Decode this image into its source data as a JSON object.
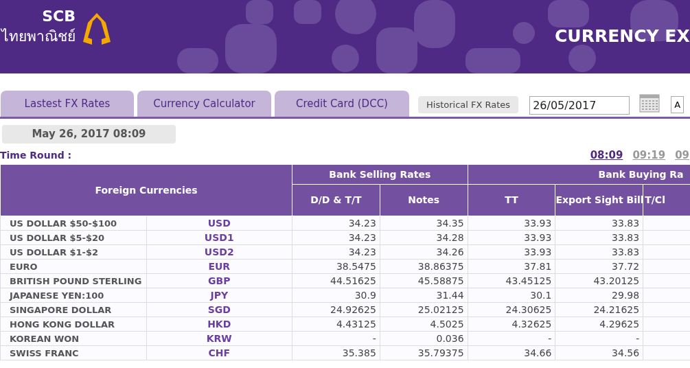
{
  "header": {
    "logo_text": "SCB",
    "logo_subtext": "ไทยพาณิชย์",
    "title": "CURRENCY EX"
  },
  "tabs": [
    {
      "label": "Lastest FX Rates",
      "selected": false
    },
    {
      "label": "Currency Calculator",
      "selected": false
    },
    {
      "label": "Credit Card (DCC)",
      "selected": false
    }
  ],
  "historical_button": "Historical FX Rates",
  "date_field": {
    "value": "26/05/2017"
  },
  "go_button": "A",
  "as_of": "May 26, 2017 08:09",
  "time_round": {
    "label": "Time Round :",
    "times": [
      {
        "label": "08:09",
        "selected": true
      },
      {
        "label": "09:19",
        "selected": false
      },
      {
        "label": "09",
        "selected": false
      }
    ]
  },
  "table": {
    "first_header": "Foreign Currencies",
    "groups": [
      {
        "label": "Bank Selling Rates",
        "columns": [
          "D/D & T/T",
          "Notes"
        ]
      },
      {
        "label": "Bank Buying Ra",
        "columns": [
          "TT",
          "Export Sight Bill",
          "T/Cl"
        ]
      }
    ],
    "rows": [
      {
        "name": "US DOLLAR $50-$100",
        "code": "USD",
        "values": [
          "34.23",
          "34.35",
          "33.93",
          "33.83"
        ]
      },
      {
        "name": "US DOLLAR $5-$20",
        "code": "USD1",
        "values": [
          "34.23",
          "34.28",
          "33.93",
          "33.83"
        ]
      },
      {
        "name": "US DOLLAR $1-$2",
        "code": "USD2",
        "values": [
          "34.23",
          "34.26",
          "33.93",
          "33.83"
        ]
      },
      {
        "name": "EURO",
        "code": "EUR",
        "values": [
          "38.5475",
          "38.86375",
          "37.81",
          "37.72"
        ]
      },
      {
        "name": "BRITISH POUND STERLING",
        "code": "GBP",
        "values": [
          "44.51625",
          "45.58875",
          "43.45125",
          "43.20125"
        ]
      },
      {
        "name": "JAPANESE YEN:100",
        "code": "JPY",
        "values": [
          "30.9",
          "31.44",
          "30.1",
          "29.98"
        ]
      },
      {
        "name": "SINGAPORE DOLLAR",
        "code": "SGD",
        "values": [
          "24.92625",
          "25.02125",
          "24.30625",
          "24.21625"
        ]
      },
      {
        "name": "HONG KONG DOLLAR",
        "code": "HKD",
        "values": [
          "4.43125",
          "4.5025",
          "4.32625",
          "4.29625"
        ]
      },
      {
        "name": "KOREAN WON",
        "code": "KRW",
        "values": [
          "-",
          "0.036",
          "-",
          "-"
        ]
      },
      {
        "name": "SWISS FRANC",
        "code": "CHF",
        "values": [
          "35.385",
          "35.79375",
          "34.66",
          "34.56"
        ]
      }
    ]
  }
}
